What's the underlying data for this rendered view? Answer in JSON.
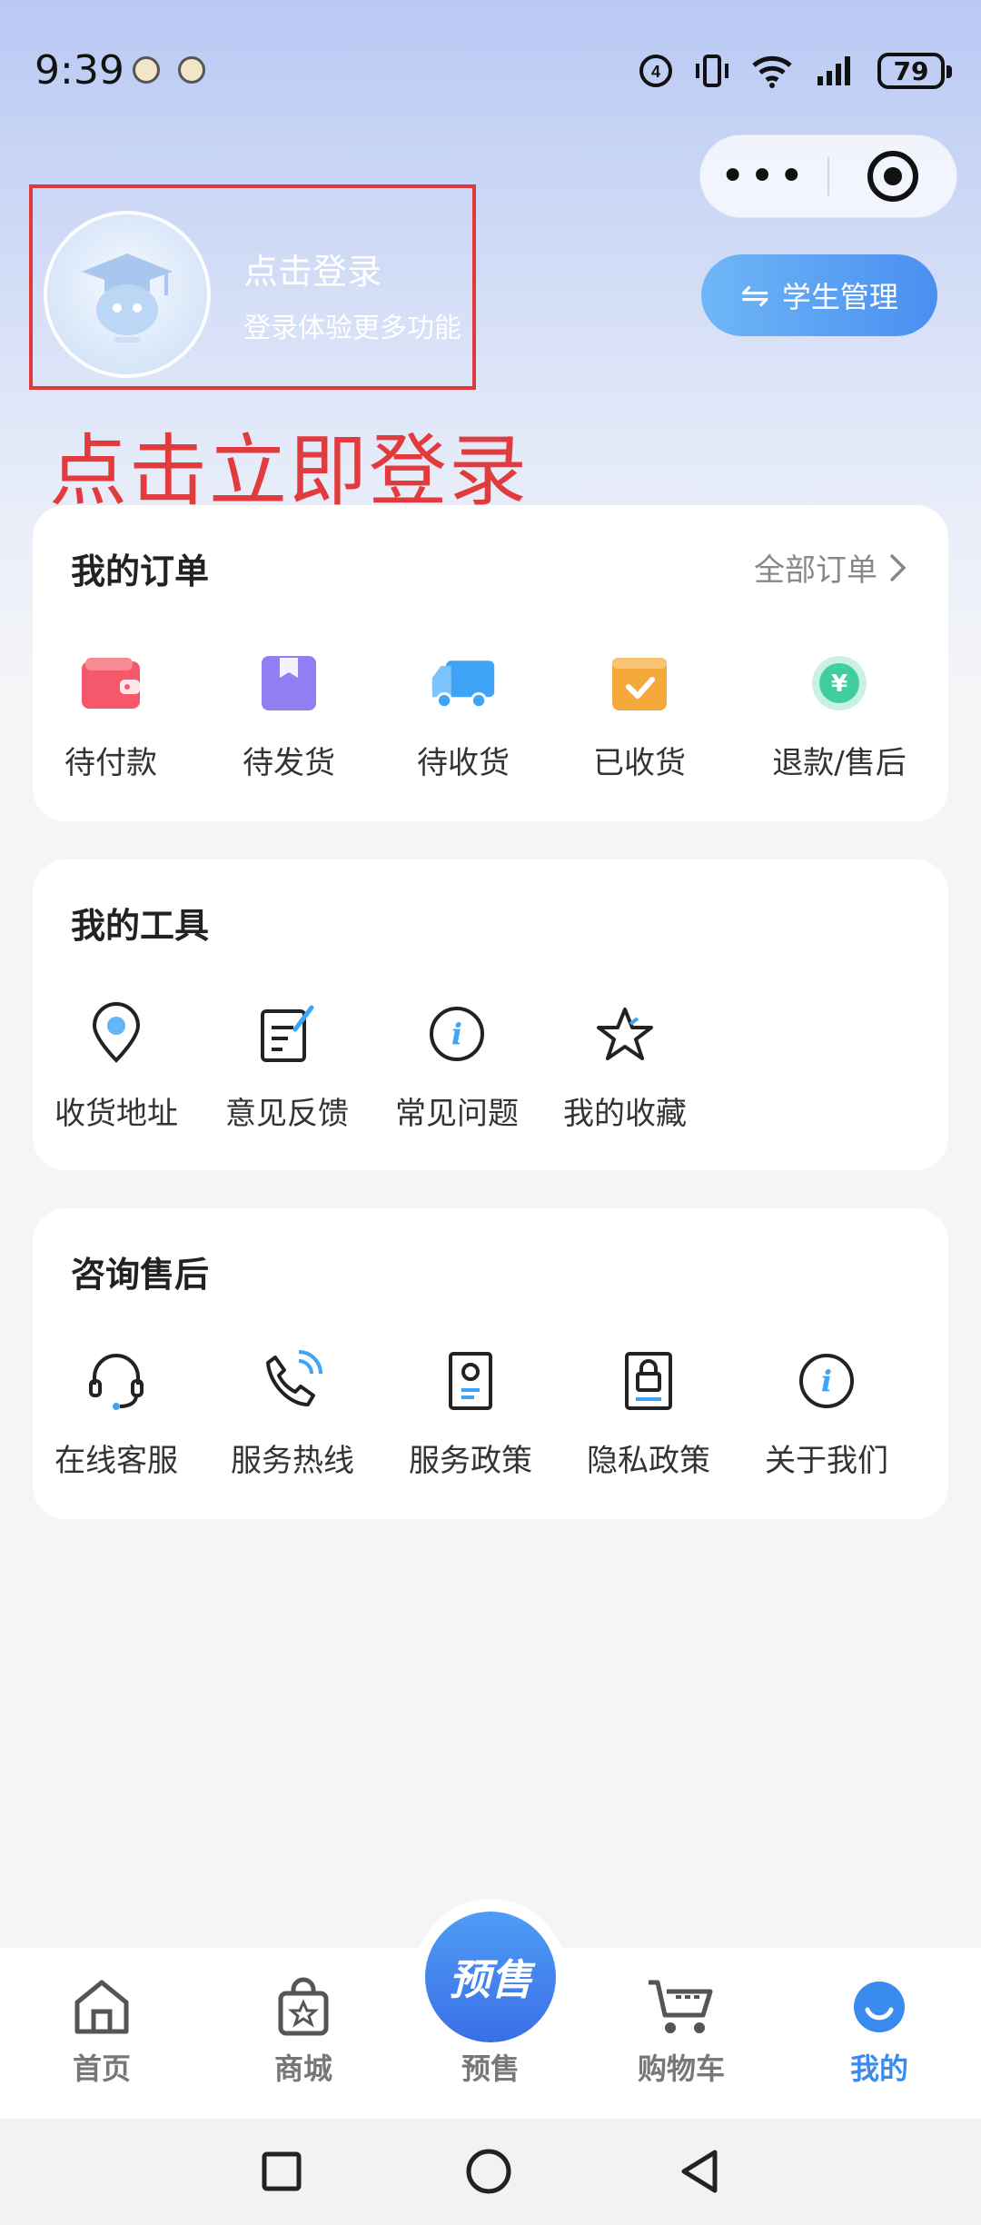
{
  "status_bar": {
    "time": "9:39",
    "battery": "79",
    "icons": [
      "data-4g-icon",
      "vibrate-icon",
      "wifi-icon",
      "signal-icon",
      "battery-icon"
    ]
  },
  "capsule": {
    "more_icon": "more-dots-icon",
    "close_icon": "target-icon"
  },
  "login": {
    "title": "点击登录",
    "subtitle": "登录体验更多功能",
    "annotation": "点击立即登录",
    "annotation_color": "#e23b3e"
  },
  "student_button": {
    "label": "学生管理"
  },
  "orders": {
    "title": "我的订单",
    "all_link": "全部订单",
    "items": [
      {
        "label": "待付款",
        "icon": "wallet-icon",
        "color": "#f5586a"
      },
      {
        "label": "待发货",
        "icon": "package-icon",
        "color": "#8f7ff2"
      },
      {
        "label": "待收货",
        "icon": "truck-icon",
        "color": "#3fa4f5"
      },
      {
        "label": "已收货",
        "icon": "received-box-icon",
        "color": "#f5a93b"
      },
      {
        "label": "退款/售后",
        "icon": "refund-icon",
        "color": "#3fcf9f"
      }
    ]
  },
  "tools": {
    "title": "我的工具",
    "items": [
      {
        "label": "收货地址",
        "icon": "location-pin-icon"
      },
      {
        "label": "意见反馈",
        "icon": "feedback-edit-icon"
      },
      {
        "label": "常见问题",
        "icon": "info-icon"
      },
      {
        "label": "我的收藏",
        "icon": "star-icon"
      }
    ]
  },
  "service": {
    "title": "咨询售后",
    "items": [
      {
        "label": "在线客服",
        "icon": "headset-icon"
      },
      {
        "label": "服务热线",
        "icon": "phone-icon"
      },
      {
        "label": "服务政策",
        "icon": "policy-document-icon"
      },
      {
        "label": "隐私政策",
        "icon": "privacy-lock-icon"
      },
      {
        "label": "关于我们",
        "icon": "info-icon"
      }
    ]
  },
  "bottom_nav": {
    "items": [
      {
        "label": "首页",
        "icon": "home-icon"
      },
      {
        "label": "商城",
        "icon": "shopping-bag-icon"
      },
      {
        "label": "预售",
        "icon": "presale-icon",
        "badge_text": "预售"
      },
      {
        "label": "购物车",
        "icon": "cart-icon"
      },
      {
        "label": "我的",
        "icon": "profile-icon",
        "active": true
      }
    ],
    "active_color": "#3a8bf0"
  },
  "system_nav": {
    "icons": [
      "recent-apps-icon",
      "home-circle-icon",
      "back-icon"
    ]
  }
}
